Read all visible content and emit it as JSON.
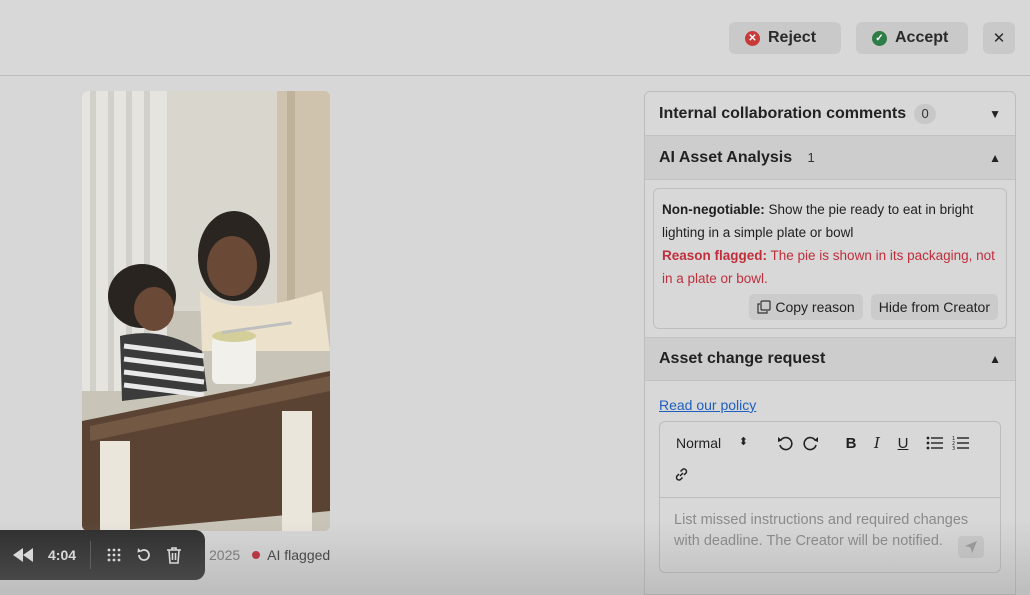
{
  "header": {
    "reject_label": "Reject",
    "accept_label": "Accept",
    "close_label": "✕"
  },
  "player": {
    "time": "4:04"
  },
  "media_meta": {
    "date_fragment": "2025",
    "flag_label": "AI flagged"
  },
  "panel": {
    "comments": {
      "title": "Internal collaboration comments",
      "count": "0"
    },
    "analysis": {
      "title": "AI Asset Analysis",
      "count": "1",
      "nonneg_label": "Non-negotiable:",
      "nonneg_text": " Show the pie ready to eat in bright lighting in a simple plate or bowl",
      "reason_label": "Reason flagged:",
      "reason_text": " The pie is shown in its packaging, not in a plate or bowl.",
      "copy_label": "Copy reason",
      "hide_label": "Hide from Creator"
    },
    "change_request": {
      "title": "Asset change request",
      "policy_link": "Read our policy",
      "format_select": "Normal",
      "placeholder": "List missed instructions and required changes with deadline. The Creator will be notified."
    }
  },
  "colors": {
    "reject": "#c83a3a",
    "accept": "#2f7d46",
    "flag": "#c0263a",
    "reason_text": "#c02e3c",
    "link": "#1f5fbf"
  }
}
